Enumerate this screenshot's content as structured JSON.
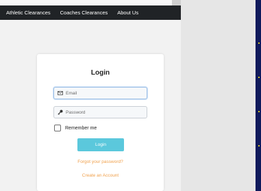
{
  "nav": {
    "items": [
      "Athletic Clearances",
      "Coaches Clearances",
      "About Us"
    ]
  },
  "login": {
    "title": "Login",
    "email_placeholder": "Email",
    "password_placeholder": "Password",
    "remember_label": "Remember me",
    "button_label": "Login",
    "forgot_link": "Forgot your password?",
    "create_link": "Create an Account"
  },
  "colors": {
    "navbar": "#202326",
    "button": "#5bc8dc",
    "link": "#f0a04b",
    "side_panel": "#101a5c"
  },
  "icons": {
    "email": "envelope-icon",
    "password": "key-icon"
  }
}
